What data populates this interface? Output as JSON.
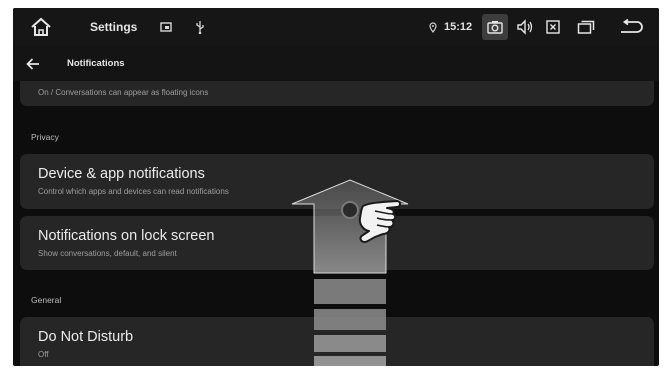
{
  "status_bar": {
    "title": "Settings",
    "time": "15:12",
    "icons": [
      "home-icon",
      "screenshot-icon",
      "usb-icon",
      "location-icon",
      "camera-icon",
      "volume-icon",
      "close-box-icon",
      "recents-icon",
      "back-icon"
    ]
  },
  "app_bar": {
    "title": "Notifications",
    "back_icon": "arrow-left-icon"
  },
  "content": {
    "partial_item": {
      "subtitle": "On / Conversations can appear as floating icons"
    },
    "privacy_header": "Privacy",
    "device_app": {
      "title": "Device & app notifications",
      "subtitle": "Control which apps and devices can read notifications"
    },
    "lock_screen": {
      "title": "Notifications on lock screen",
      "subtitle": "Show conversations, default, and silent"
    },
    "general_header": "General",
    "dnd": {
      "title": "Do Not Disturb",
      "subtitle": "Off"
    }
  },
  "gesture": {
    "type": "swipe-up",
    "icon": "hand-tap-icon"
  },
  "colors": {
    "background": "#0d0d0d",
    "card": "#262626",
    "text": "#ececec",
    "subtext": "#9e9e9e"
  }
}
